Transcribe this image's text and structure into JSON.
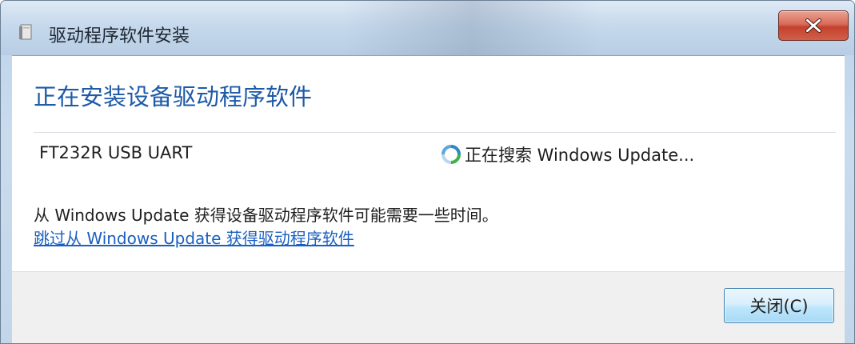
{
  "window": {
    "title": "驱动程序软件安装"
  },
  "content": {
    "heading": "正在安装设备驱动程序软件",
    "device_name": "FT232R USB UART",
    "status_text": "正在搜索 Windows Update...",
    "info_text": "从 Windows Update 获得设备驱动程序软件可能需要一些时间。",
    "skip_link": "跳过从 Windows Update 获得驱动程序软件"
  },
  "footer": {
    "close_button_label": "关闭(C)"
  },
  "icons": {
    "title_icon": "driver-box-icon",
    "status_icon": "busy-spinner-icon",
    "window_close_icon": "close-icon"
  },
  "colors": {
    "heading": "#1d5aa8",
    "link": "#1a5fc2",
    "close_button": "#c4412c"
  }
}
